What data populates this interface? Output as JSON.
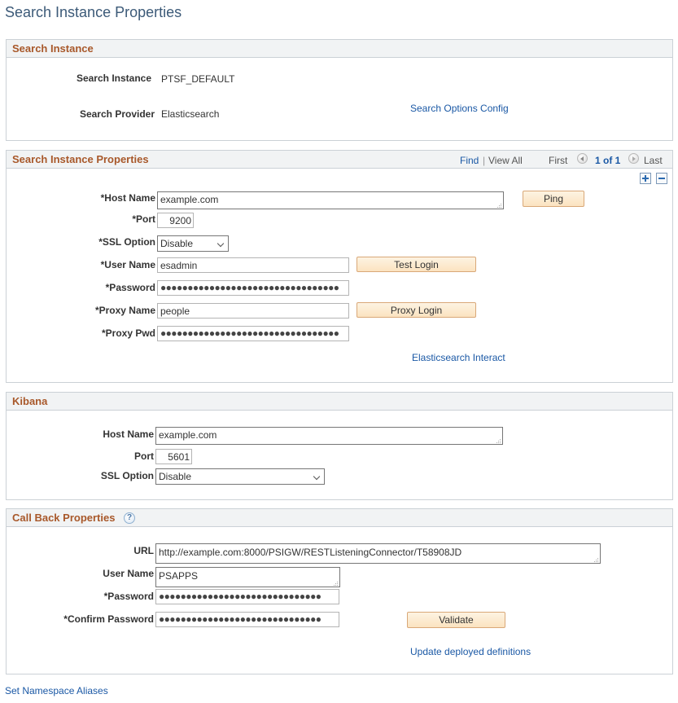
{
  "page": {
    "title": "Search Instance Properties"
  },
  "search_instance_box": {
    "title": "Search Instance",
    "instance_label": "Search Instance",
    "instance_value": "PTSF_DEFAULT",
    "provider_label": "Search Provider",
    "provider_value": "Elasticsearch",
    "options_link": "Search Options Config"
  },
  "properties_box": {
    "title": "Search Instance Properties",
    "nav": {
      "find": "Find",
      "separator": "|",
      "view_all": "View All",
      "first": "First",
      "page_status": "1 of 1",
      "last": "Last"
    },
    "fields": {
      "host_name": {
        "label": "*Host Name",
        "value": "example.com"
      },
      "port": {
        "label": "*Port",
        "value": "9200"
      },
      "ssl_option": {
        "label": "*SSL Option",
        "value": "Disable"
      },
      "user_name": {
        "label": "*User Name",
        "value": "esadmin"
      },
      "password": {
        "label": "*Password",
        "value": "●●●●●●●●●●●●●●●●●●●●●●●●●●●●●●●●●"
      },
      "proxy_name": {
        "label": "*Proxy Name",
        "value": "people"
      },
      "proxy_pwd": {
        "label": "*Proxy Pwd",
        "value": "●●●●●●●●●●●●●●●●●●●●●●●●●●●●●●●●●"
      }
    },
    "buttons": {
      "ping": "Ping",
      "test_login": "Test Login",
      "proxy_login": "Proxy Login"
    },
    "interact_link": "Elasticsearch Interact"
  },
  "kibana_box": {
    "title": "Kibana",
    "fields": {
      "host_name": {
        "label": "Host Name",
        "value": "example.com"
      },
      "port": {
        "label": "Port",
        "value": "5601"
      },
      "ssl_option": {
        "label": "SSL Option",
        "value": "Disable"
      }
    }
  },
  "callback_box": {
    "title": "Call Back Properties",
    "help_glyph": "?",
    "fields": {
      "url": {
        "label": "URL",
        "value": "http://example.com:8000/PSIGW/RESTListeningConnector/T58908JD"
      },
      "user_name": {
        "label": "User Name",
        "value": "PSAPPS"
      },
      "password": {
        "label": "*Password",
        "value": "●●●●●●●●●●●●●●●●●●●●●●●●●●●●●●"
      },
      "confirm_password": {
        "label": "*Confirm Password",
        "value": "●●●●●●●●●●●●●●●●●●●●●●●●●●●●●●"
      }
    },
    "validate_button": "Validate",
    "update_link": "Update deployed definitions"
  },
  "footer": {
    "namespace_link": "Set Namespace Aliases"
  }
}
